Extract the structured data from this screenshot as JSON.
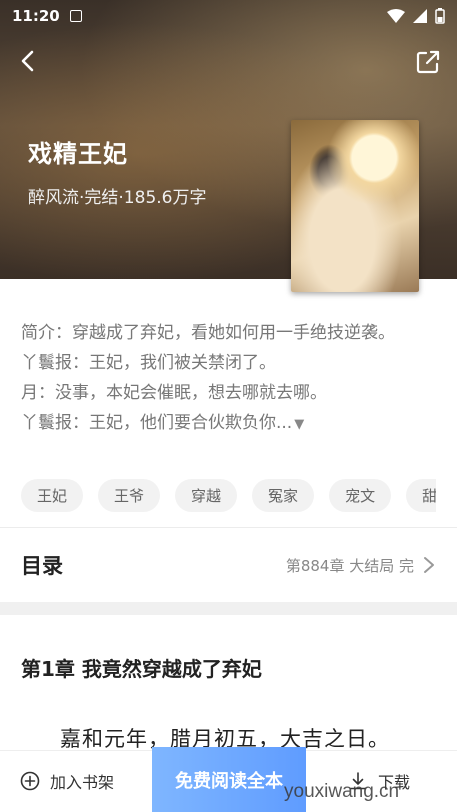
{
  "status_bar": {
    "time": "11:20"
  },
  "book": {
    "title": "戏精王妃",
    "meta": "醉风流·完结·185.6万字"
  },
  "intro": {
    "lines": [
      "简介：穿越成了弃妃，看她如何用一手绝技逆袭。",
      "丫鬟报：王妃，我们被关禁闭了。",
      "月：没事，本妃会催眠，想去哪就去哪。",
      "丫鬟报：王妃，他们要合伙欺负你..."
    ],
    "more_icon": "triangle-down-icon"
  },
  "tags": [
    "王妃",
    "王爷",
    "穿越",
    "冤家",
    "宠文",
    "甜"
  ],
  "catalog": {
    "label": "目录",
    "latest": "第884章 大结局 完"
  },
  "chapter": {
    "title": "第1章 我竟然穿越成了弃妃",
    "first_line": "嘉和元年，腊月初五，大吉之日。"
  },
  "bottom_bar": {
    "add_shelf": "加入书架",
    "read_free": "免费阅读全本",
    "download": "下载"
  },
  "watermark": "youxiwang.cn",
  "colors": {
    "accent": "#5f9cff",
    "hero_bg": "#4a3c30"
  }
}
